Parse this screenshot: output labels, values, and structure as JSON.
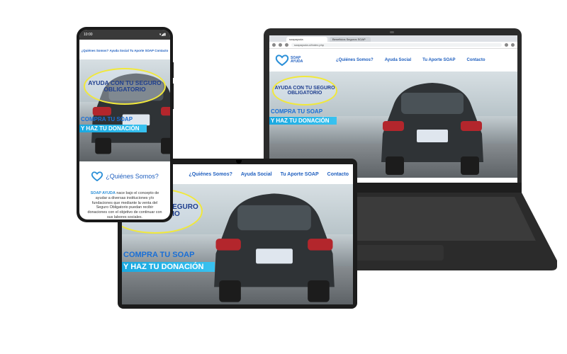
{
  "phone": {
    "status_time": "10:00",
    "status_icons": "▾◢▮",
    "nav": [
      "¿Quiénes Somos?",
      "Ayuda Social",
      "Tu Aporte SOAP",
      "Contacto"
    ],
    "hero_ellipse": "AYUDA CON TU SEGURO OBLIGATORIO",
    "hero_cta1": "COMPRA TU SOAP",
    "hero_cta2": "Y HAZ TU DONACIÓN",
    "section_title": "¿Quiénes Somos?",
    "about_brand": "SOAP AYUDA",
    "about_text": "nace bajo el concepto de ayudar a diversas instituciones y/o fundaciones que mediante la venta del Seguro Obligatorio puedan recibir donaciones con el objetivo de continuar con sus labores sociales."
  },
  "tablet": {
    "nav": [
      "¿Quiénes Somos?",
      "Ayuda Social",
      "Tu Aporte SOAP",
      "Contacto"
    ],
    "hero_ellipse": "AYUDA CON TU SEGURO OBLIGATORIO",
    "hero_cta1": "COMPRA TU SOAP",
    "hero_cta2": "Y HAZ TU DONACIÓN"
  },
  "laptop": {
    "tabs": [
      "soapayuda",
      "Beneficios Seguros SOAP"
    ],
    "url": "soapayuda.cl/index.php",
    "logo_text": "SOAP AYUDA",
    "nav": [
      "¿Quiénes Somos?",
      "Ayuda Social",
      "Tu Aporte SOAP",
      "Contacto"
    ],
    "hero_ellipse": "AYUDA CON TU SEGURO OBLIGATORIO",
    "hero_cta1": "COMPRA TU SOAP",
    "hero_cta2": "Y HAZ TU DONACIÓN"
  },
  "colors": {
    "brand_blue": "#1f5fbf",
    "accent_cyan": "#1aa8e0",
    "highlight_yellow": "#f1e83a"
  }
}
